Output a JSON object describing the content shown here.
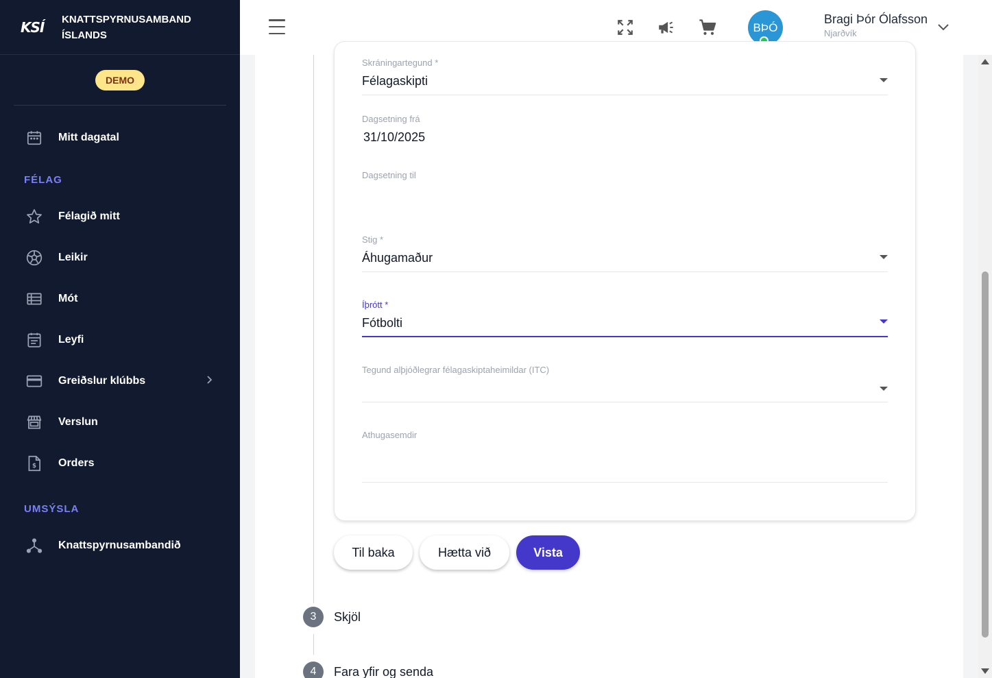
{
  "brand": {
    "logo": "KSÍ",
    "name_line1": "KNATTSPYRNUSAMBAND",
    "name_line2": "ÍSLANDS",
    "demo_badge": "DEMO"
  },
  "sidebar": {
    "calendar_label": "Mitt dagatal",
    "section_felag": "FÉLAG",
    "items": [
      {
        "label": "Félagið mitt",
        "icon": "star-icon"
      },
      {
        "label": "Leikir",
        "icon": "soccer-ball-icon"
      },
      {
        "label": "Mót",
        "icon": "list-table-icon"
      },
      {
        "label": "Leyfi",
        "icon": "document-icon"
      },
      {
        "label": "Greiðslur klúbbs",
        "icon": "credit-card-icon"
      },
      {
        "label": "Verslun",
        "icon": "storefront-icon"
      },
      {
        "label": "Orders",
        "icon": "invoice-icon"
      }
    ],
    "section_umsysla": "UMSÝSLA",
    "admin_item": "Knattspyrnusambandið"
  },
  "topbar": {
    "user_initials": "BÞÓ",
    "user_name": "Bragi Þór Ólafsson",
    "user_club": "Njarðvík"
  },
  "form": {
    "registration_type": {
      "label": "Skráningartegund *",
      "value": "Félagaskipti"
    },
    "date_from": {
      "label": "Dagsetning frá",
      "value": "31/10/2025"
    },
    "date_to": {
      "label": "Dagsetning til",
      "value": ""
    },
    "level": {
      "label": "Stig *",
      "value": "Áhugamaður"
    },
    "sport": {
      "label": "Íþrótt *",
      "value": "Fótbolti"
    },
    "itc_type": {
      "label": "Tegund alþjóðlegrar félagaskiptaheimildar (ITC)",
      "value": ""
    },
    "remarks": {
      "label": "Athugasemdir",
      "value": ""
    }
  },
  "buttons": {
    "back": "Til baka",
    "cancel": "Hætta við",
    "save": "Vista"
  },
  "steps": [
    {
      "number": "3",
      "title": "Skjöl"
    },
    {
      "number": "4",
      "title": "Fara yfir og senda"
    }
  ]
}
